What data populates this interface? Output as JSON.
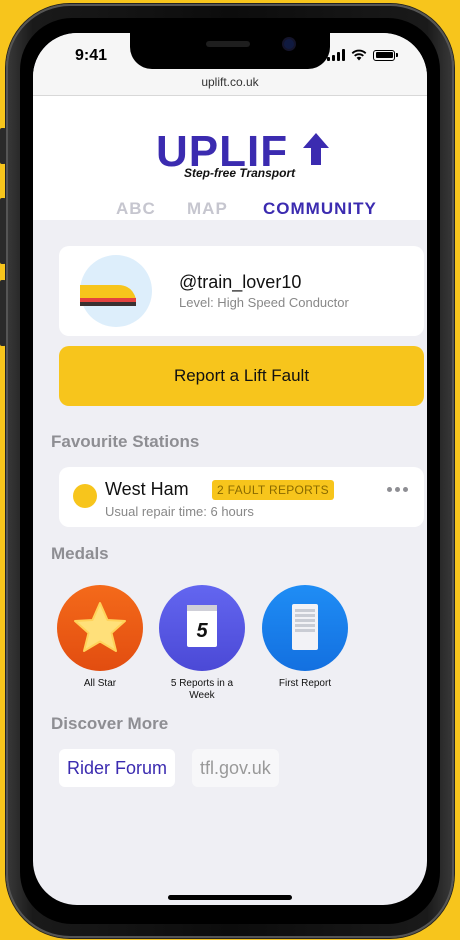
{
  "status_bar": {
    "time": "9:41"
  },
  "browser": {
    "url": "uplift.co.uk"
  },
  "brand": {
    "logo_text": "UPLIF",
    "tagline": "Step-free Transport",
    "accent": "#3b2bb0",
    "highlight": "#f7c51c"
  },
  "nav": {
    "tabs": [
      {
        "label": "ABC",
        "active": false
      },
      {
        "label": "MAP",
        "active": false
      },
      {
        "label": "COMMUNITY",
        "active": true
      }
    ]
  },
  "profile": {
    "username": "@train_lover10",
    "level": "Level: High Speed Conductor",
    "avatar_icon": "train-icon"
  },
  "report_button": {
    "label": "Report a Lift Fault"
  },
  "favourites": {
    "title": "Favourite Stations",
    "stations": [
      {
        "name": "West Ham",
        "badge": "2 FAULT REPORTS",
        "repair": "Usual repair time: 6 hours"
      }
    ]
  },
  "medals": {
    "title": "Medals",
    "items": [
      {
        "label": "All Star",
        "icon": "star-icon"
      },
      {
        "label": "5 Reports in a Week",
        "icon": "calendar-icon",
        "number": "5"
      },
      {
        "label": "First Report",
        "icon": "document-icon"
      }
    ]
  },
  "discover": {
    "title": "Discover More",
    "links": [
      {
        "label": "Rider Forum"
      },
      {
        "label": "tfl.gov.uk"
      }
    ]
  }
}
